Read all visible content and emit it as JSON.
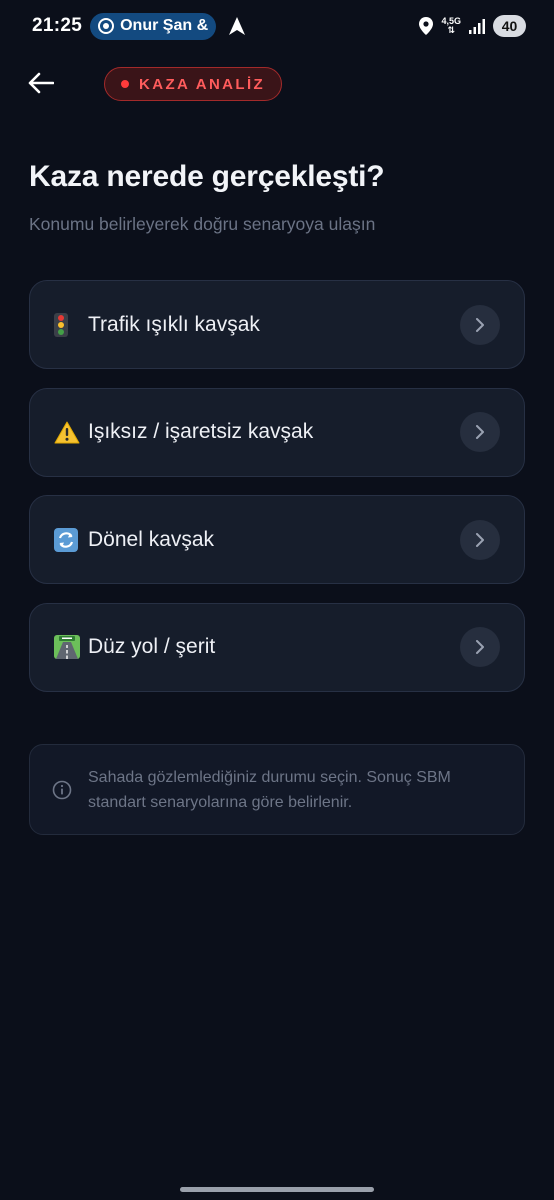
{
  "status_bar": {
    "time": "21:25",
    "call_name": "Onur Şan &",
    "network": "4,5G",
    "battery": "40"
  },
  "header": {
    "badge_label": "KAZA ANALİZ"
  },
  "page": {
    "title": "Kaza nerede gerçekleşti?",
    "subtitle": "Konumu belirleyerek doğru senaryoya ulaşın"
  },
  "options": [
    {
      "icon": "traffic-light-icon",
      "label": "Trafik ışıklı kavşak"
    },
    {
      "icon": "warning-icon",
      "label": "Işıksız / işaretsiz kavşak"
    },
    {
      "icon": "counterclockwise-arrows-icon",
      "label": "Dönel kavşak"
    },
    {
      "icon": "motorway-icon",
      "label": "Düz yol / şerit"
    }
  ],
  "info": {
    "text": "Sahada gözlemlediğiniz durumu seçin. Sonuç SBM standart senaryolarına göre belirlenir."
  },
  "colors": {
    "background": "#0b0f1a",
    "card": "#161d2b",
    "accent_red": "#ff5c5c",
    "pill_blue": "#134a80"
  }
}
